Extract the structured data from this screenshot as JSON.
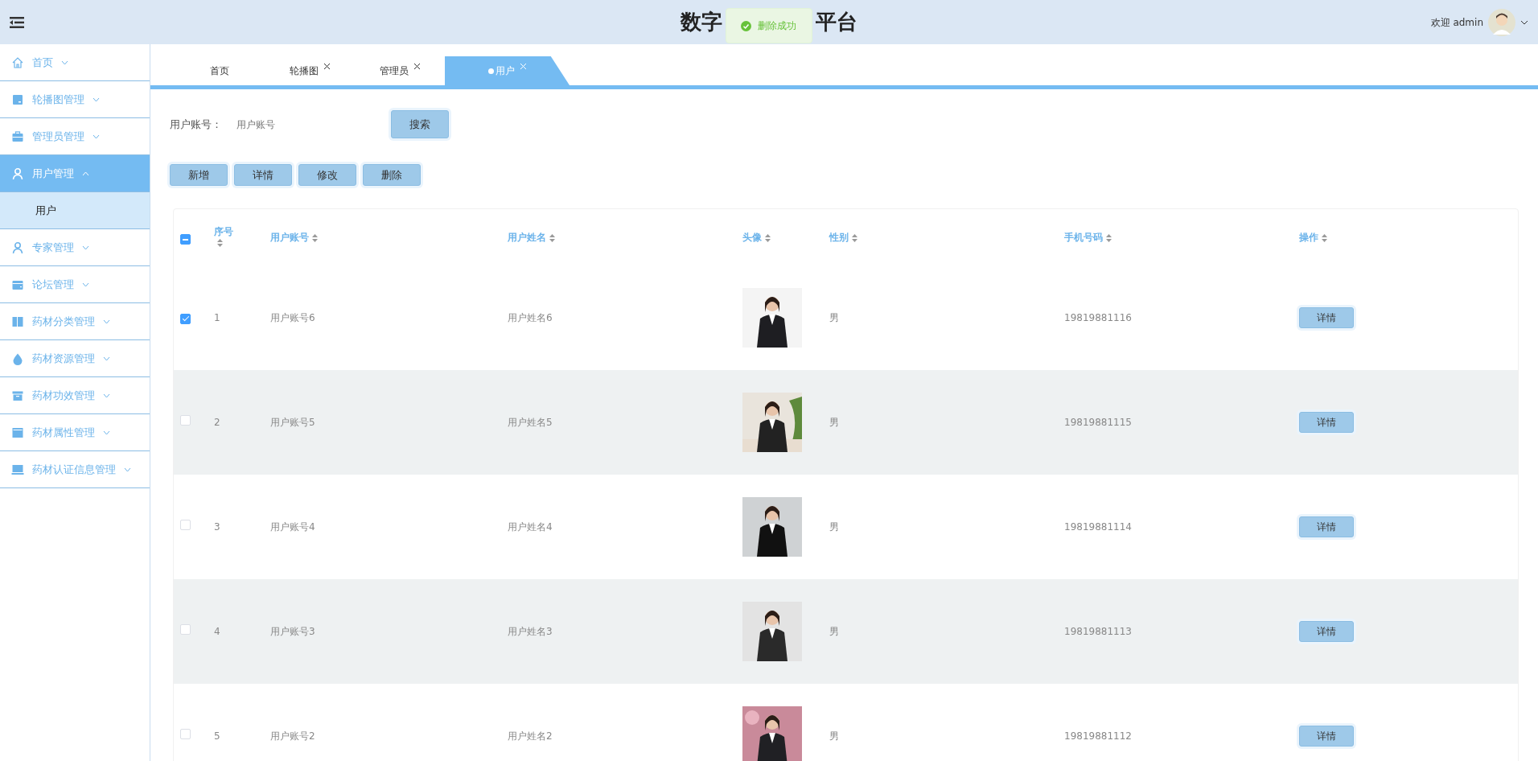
{
  "header": {
    "title_left": "数字",
    "title_right": "平台",
    "welcome": "欢迎 admin"
  },
  "toast": {
    "message": "删除成功"
  },
  "sidebar": {
    "items": [
      {
        "label": "首页",
        "expanded": false,
        "selected": false
      },
      {
        "label": "轮播图管理",
        "expanded": false,
        "selected": false
      },
      {
        "label": "管理员管理",
        "expanded": false,
        "selected": false
      },
      {
        "label": "用户管理",
        "expanded": true,
        "selected": true,
        "children": [
          {
            "label": "用户",
            "selected": true
          }
        ]
      },
      {
        "label": "专家管理",
        "expanded": false,
        "selected": false
      },
      {
        "label": "论坛管理",
        "expanded": false,
        "selected": false
      },
      {
        "label": "药材分类管理",
        "expanded": false,
        "selected": false
      },
      {
        "label": "药材资源管理",
        "expanded": false,
        "selected": false
      },
      {
        "label": "药材功效管理",
        "expanded": false,
        "selected": false
      },
      {
        "label": "药材属性管理",
        "expanded": false,
        "selected": false
      },
      {
        "label": "药材认证信息管理",
        "expanded": false,
        "selected": false
      }
    ]
  },
  "tabs": [
    {
      "label": "首页",
      "closable": false,
      "selected": false
    },
    {
      "label": "轮播图",
      "closable": true,
      "selected": false
    },
    {
      "label": "管理员",
      "closable": true,
      "selected": false
    },
    {
      "label": "用户",
      "closable": true,
      "selected": true
    }
  ],
  "search": {
    "label": "用户账号：",
    "placeholder": "用户账号",
    "button": "搜索"
  },
  "actions": [
    "新增",
    "详情",
    "修改",
    "删除"
  ],
  "table": {
    "select_all": {
      "indeterminate": true
    },
    "columns": [
      "序号",
      "用户账号",
      "用户姓名",
      "头像",
      "性别",
      "手机号码",
      "操作"
    ],
    "rows": [
      {
        "checked": true,
        "index": "1",
        "account": "用户账号6",
        "name": "用户姓名6",
        "gender": "男",
        "phone": "19819881116",
        "action": "详情"
      },
      {
        "checked": false,
        "index": "2",
        "account": "用户账号5",
        "name": "用户姓名5",
        "gender": "男",
        "phone": "19819881115",
        "action": "详情"
      },
      {
        "checked": false,
        "index": "3",
        "account": "用户账号4",
        "name": "用户姓名4",
        "gender": "男",
        "phone": "19819881114",
        "action": "详情"
      },
      {
        "checked": false,
        "index": "4",
        "account": "用户账号3",
        "name": "用户姓名3",
        "gender": "男",
        "phone": "19819881113",
        "action": "详情"
      },
      {
        "checked": false,
        "index": "5",
        "account": "用户账号2",
        "name": "用户姓名2",
        "gender": "男",
        "phone": "19819881112",
        "action": "详情"
      }
    ]
  }
}
